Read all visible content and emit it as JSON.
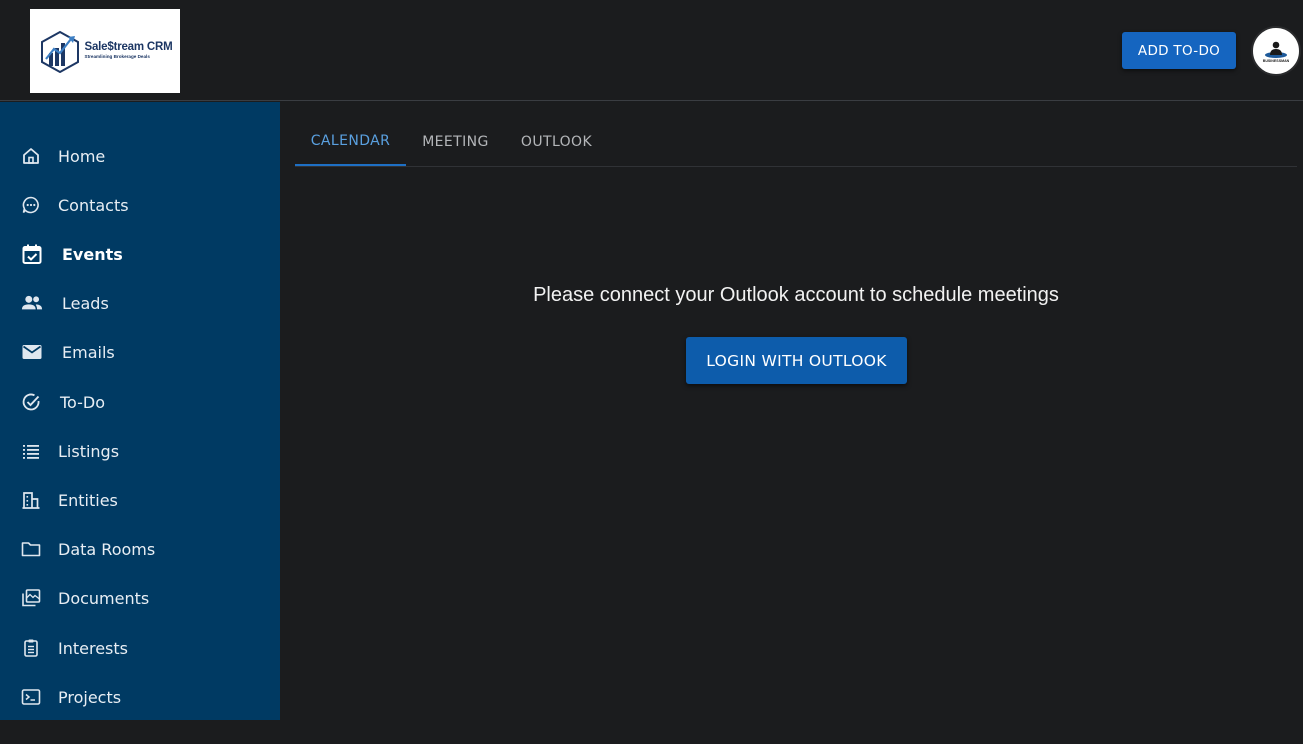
{
  "header": {
    "logo_title": "Sale$tream CRM",
    "logo_subtitle": "Streamlining Brokerage Deals",
    "add_todo_label": "ADD TO-DO",
    "avatar_caption": "BUSINESSMAN"
  },
  "sidebar": {
    "items": [
      {
        "label": "Home",
        "icon": "home-icon"
      },
      {
        "label": "Contacts",
        "icon": "chat-icon"
      },
      {
        "label": "Events",
        "icon": "calendar-check-icon",
        "active": true
      },
      {
        "label": "Leads",
        "icon": "people-icon"
      },
      {
        "label": "Emails",
        "icon": "mail-icon"
      },
      {
        "label": "To-Do",
        "icon": "check-circle-icon"
      },
      {
        "label": "Listings",
        "icon": "list-icon"
      },
      {
        "label": "Entities",
        "icon": "building-icon"
      },
      {
        "label": "Data Rooms",
        "icon": "folder-icon"
      },
      {
        "label": "Documents",
        "icon": "library-icon"
      },
      {
        "label": "Interests",
        "icon": "clipboard-icon"
      },
      {
        "label": "Projects",
        "icon": "terminal-icon"
      }
    ]
  },
  "tabs": [
    {
      "label": "CALENDAR",
      "active": true
    },
    {
      "label": "MEETING"
    },
    {
      "label": "OUTLOOK"
    }
  ],
  "main": {
    "message": "Please connect your Outlook account to schedule meetings",
    "login_label": "LOGIN WITH OUTLOOK"
  },
  "colors": {
    "background": "#1b1c1e",
    "sidebar": "#003a63",
    "primary_button": "#1565c0",
    "active_tab": "#5aa0e0"
  }
}
